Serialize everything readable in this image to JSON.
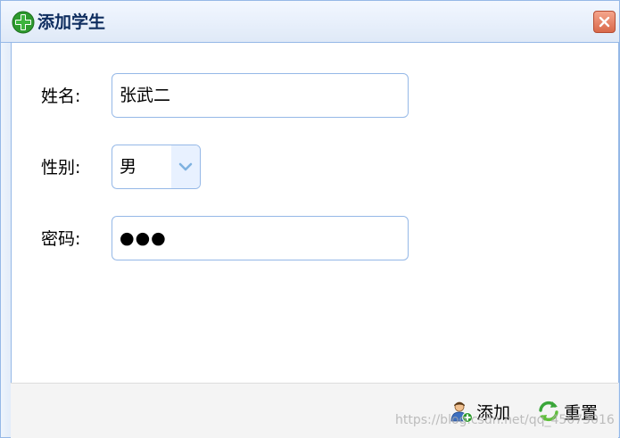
{
  "dialog": {
    "title": "添加学生",
    "title_icon": "add-icon",
    "close_icon": "close-icon"
  },
  "form": {
    "name_label": "姓名:",
    "name_value": "张武二",
    "gender_label": "性别:",
    "gender_value": "男",
    "password_label": "密码:",
    "password_value": "●●●"
  },
  "footer": {
    "add_label": "添加",
    "add_icon": "user-add-icon",
    "reset_label": "重置",
    "reset_icon": "refresh-icon"
  },
  "watermark": "https://blog.csdn.net/qq_45073016",
  "colors": {
    "border": "#95b8e7",
    "title_text": "#0e2d5f",
    "close": "#d9694a",
    "footer_bg": "#f4f4f4"
  }
}
